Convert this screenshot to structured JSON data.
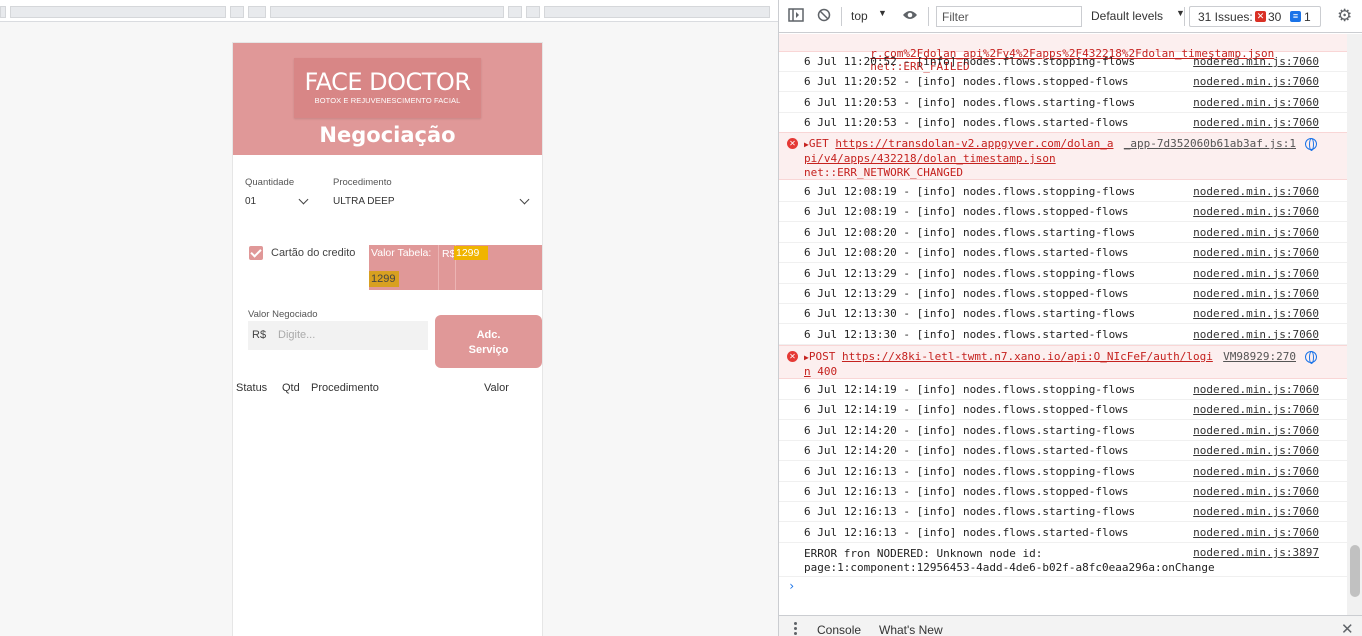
{
  "app": {
    "logo_title": "FACE DOCTOR",
    "logo_subtitle": "BOTOX E REJUVENESCIMENTO FACIAL",
    "page_title": "Negociação",
    "quantidade_label": "Quantidade",
    "quantidade_value": "01",
    "procedimento_label": "Procedimento",
    "procedimento_value": "ULTRA DEEP",
    "checkbox_label": "Cartão do credito",
    "checkbox_checked": true,
    "valor_tabela_label": "Valor Tabela:",
    "valor_tabela_currency": "R$",
    "valor_tabela_value": "1299",
    "valor_tabela_value2": "1299",
    "valor_negociado_label": "Valor Negociado",
    "valor_negociado_currency": "R$",
    "valor_negociado_placeholder": "Digite...",
    "add_button_line1": "Adc.",
    "add_button_line2": "Serviço",
    "table_headers": [
      "Status",
      "Qtd",
      "Procedimento",
      "Valor"
    ],
    "accent_color": "#e09898"
  },
  "devtools": {
    "context": "top",
    "filter_placeholder": "Filter",
    "levels": "Default levels",
    "issues_label": "31 Issues:",
    "issues_errors": "30",
    "issues_info": "1",
    "err_top_line1": "r.com%2Fdolan_api%2Fv4%2Fapps%2F432218%2Fdolan_timestamp.json",
    "err_top_line1_status": "net::ERR_FAILED",
    "logs_a": [
      {
        "msg": "6 Jul 11:20:52 - [info] nodes.flows.stopping-flows",
        "src": "nodered.min.js:7060"
      },
      {
        "msg": "6 Jul 11:20:52 - [info] nodes.flows.stopped-flows",
        "src": "nodered.min.js:7060"
      },
      {
        "msg": "6 Jul 11:20:53 - [info] nodes.flows.starting-flows",
        "src": "nodered.min.js:7060"
      },
      {
        "msg": "6 Jul 11:20:53 - [info] nodes.flows.started-flows",
        "src": "nodered.min.js:7060"
      }
    ],
    "err_get": {
      "method": "GET",
      "url_line1": "https://transdolan-v2.appgyver.com/dolan_a",
      "url_line2": "pi/v4/apps/432218/dolan_timestamp.json",
      "status": "net::ERR_NETWORK_CHANGED",
      "src": "_app-7d352060b61ab3af.js:1"
    },
    "logs_b": [
      {
        "msg": "6 Jul 12:08:19 - [info] nodes.flows.stopping-flows",
        "src": "nodered.min.js:7060"
      },
      {
        "msg": "6 Jul 12:08:19 - [info] nodes.flows.stopped-flows",
        "src": "nodered.min.js:7060"
      },
      {
        "msg": "6 Jul 12:08:20 - [info] nodes.flows.starting-flows",
        "src": "nodered.min.js:7060"
      },
      {
        "msg": "6 Jul 12:08:20 - [info] nodes.flows.started-flows",
        "src": "nodered.min.js:7060"
      },
      {
        "msg": "6 Jul 12:13:29 - [info] nodes.flows.stopping-flows",
        "src": "nodered.min.js:7060"
      },
      {
        "msg": "6 Jul 12:13:29 - [info] nodes.flows.stopped-flows",
        "src": "nodered.min.js:7060"
      },
      {
        "msg": "6 Jul 12:13:30 - [info] nodes.flows.starting-flows",
        "src": "nodered.min.js:7060"
      },
      {
        "msg": "6 Jul 12:13:30 - [info] nodes.flows.started-flows",
        "src": "nodered.min.js:7060"
      }
    ],
    "err_post": {
      "method": "POST",
      "url_line1": "https://x8ki-letl-twmt.n7.xano.io/api:O_NIcFeF/auth/logi",
      "url_line2": "n",
      "status": "400",
      "src": "VM98929:270"
    },
    "logs_c": [
      {
        "msg": "6 Jul 12:14:19 - [info] nodes.flows.stopping-flows",
        "src": "nodered.min.js:7060"
      },
      {
        "msg": "6 Jul 12:14:19 - [info] nodes.flows.stopped-flows",
        "src": "nodered.min.js:7060"
      },
      {
        "msg": "6 Jul 12:14:20 - [info] nodes.flows.starting-flows",
        "src": "nodered.min.js:7060"
      },
      {
        "msg": "6 Jul 12:14:20 - [info] nodes.flows.started-flows",
        "src": "nodered.min.js:7060"
      },
      {
        "msg": "6 Jul 12:16:13 - [info] nodes.flows.stopping-flows",
        "src": "nodered.min.js:7060"
      },
      {
        "msg": "6 Jul 12:16:13 - [info] nodes.flows.stopped-flows",
        "src": "nodered.min.js:7060"
      },
      {
        "msg": "6 Jul 12:16:13 - [info] nodes.flows.starting-flows",
        "src": "nodered.min.js:7060"
      },
      {
        "msg": "6 Jul 12:16:13 - [info] nodes.flows.started-flows",
        "src": "nodered.min.js:7060"
      }
    ],
    "final_error": {
      "line1": "ERROR fron NODERED: Unknown node id:",
      "line2": "page:1:component:12956453-4add-4de6-b02f-a8fc0eaa296a:onChange",
      "src": "nodered.min.js:3897"
    },
    "drawer_tabs": [
      "Console",
      "What's New"
    ]
  }
}
